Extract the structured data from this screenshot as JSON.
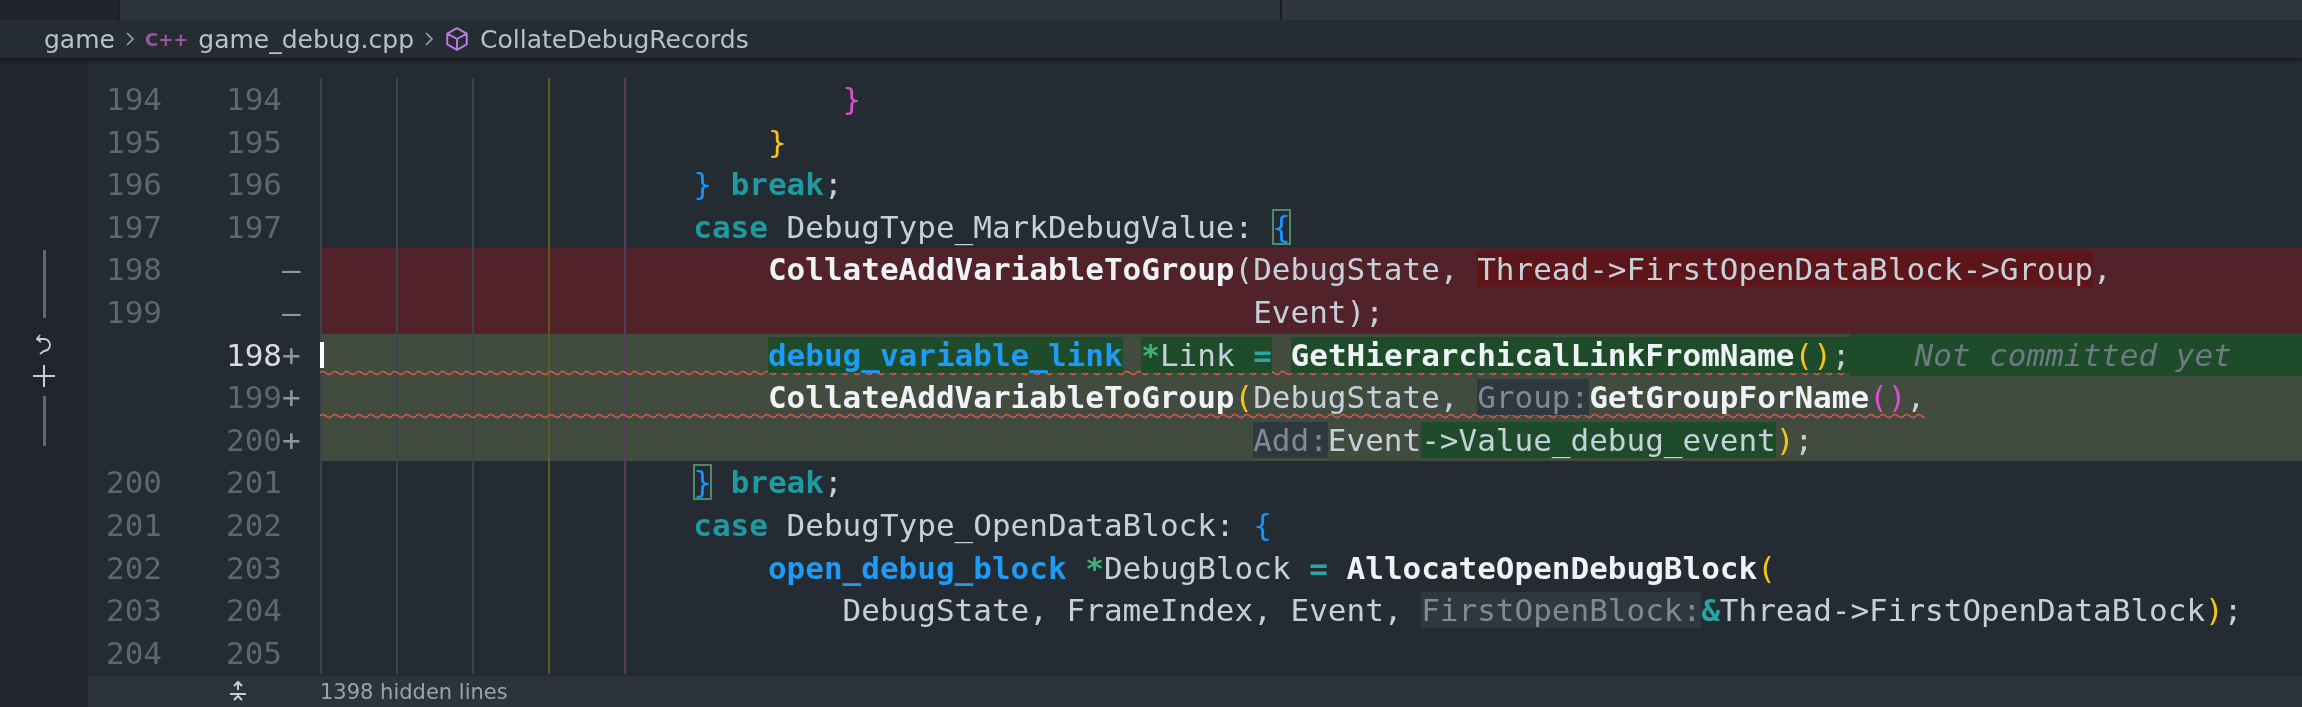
{
  "breadcrumb": [
    {
      "label": "game"
    },
    {
      "label": "game_debug.cpp",
      "icon_text": "C++"
    },
    {
      "label": "CollateDebugRecords",
      "kind": "symbol"
    }
  ],
  "lines": [
    {
      "old": "194",
      "new": "194",
      "kind": "context",
      "current": false,
      "squiggle": false,
      "tokens": [
        {
          "text": "                            }",
          "kind": "bracket3"
        }
      ]
    },
    {
      "old": "195",
      "new": "195",
      "kind": "context",
      "current": false,
      "squiggle": false,
      "tokens": [
        {
          "text": "                        }",
          "kind": "bracket2"
        }
      ]
    },
    {
      "old": "196",
      "new": "196",
      "kind": "context",
      "current": false,
      "squiggle": false,
      "tokens": [
        {
          "text": "                    }",
          "kind": "bracket1"
        },
        {
          "text": " break",
          "kind": "keyword"
        },
        {
          "text": ";",
          "kind": "plain"
        }
      ]
    },
    {
      "old": "197",
      "new": "197",
      "kind": "context",
      "current": false,
      "squiggle": false,
      "tokens": [
        {
          "text": "                    case",
          "kind": "keyword"
        },
        {
          "text": " DebugType_MarkDebugValue: ",
          "kind": "plain"
        },
        {
          "text": "{",
          "kind": "bracket1",
          "boxed": true
        }
      ]
    },
    {
      "old": "198",
      "sign": "—",
      "kind": "removed",
      "current": false,
      "squiggle": false,
      "tokens": [
        {
          "text": "                        CollateAddVariableToGroup",
          "kind": "function"
        },
        {
          "text": "(DebugState, ",
          "kind": "plain"
        },
        {
          "text": "Thread->FirstOpenDataBlock->Group",
          "kind": "plain",
          "changed": true
        },
        {
          "text": ",",
          "kind": "plain"
        }
      ]
    },
    {
      "old": "199",
      "sign": "—",
      "kind": "removed",
      "current": false,
      "squiggle": false,
      "tokens": [
        {
          "text": "                                                  Event);",
          "kind": "plain"
        }
      ]
    },
    {
      "new": "198",
      "sign": "+",
      "kind": "added",
      "current": true,
      "squiggle": true,
      "tokens": [
        {
          "text": "                        debug_variable_link",
          "kind": "type",
          "changed": true
        },
        {
          "text": " *",
          "kind": "star",
          "changed": true
        },
        {
          "text": "Link ",
          "kind": "plain",
          "changed": true
        },
        {
          "text": "=",
          "kind": "operator",
          "changed": true
        },
        {
          "text": " GetHierarchicalLinkFromName",
          "kind": "function",
          "changed": true
        },
        {
          "text": "()",
          "kind": "bracket2",
          "changed": true
        },
        {
          "text": ";",
          "kind": "plain",
          "changed": true
        }
      ],
      "annotation": "Not committed yet"
    },
    {
      "new": "199",
      "sign": "+",
      "kind": "added",
      "current": false,
      "squiggle": true,
      "tokens": [
        {
          "text": "                        CollateAddVariableToGroup",
          "kind": "function"
        },
        {
          "text": "(",
          "kind": "bracket2"
        },
        {
          "text": "DebugState, ",
          "kind": "plain"
        },
        {
          "text": "Group:",
          "kind": "hint"
        },
        {
          "text": "GetGroupForName",
          "kind": "function"
        },
        {
          "text": "()",
          "kind": "bracket3"
        },
        {
          "text": ",",
          "kind": "plain"
        }
      ]
    },
    {
      "new": "200",
      "sign": "+",
      "kind": "added",
      "current": false,
      "squiggle": false,
      "tokens": [
        {
          "text": "                                                  Add:",
          "kind": "hint"
        },
        {
          "text": "Event",
          "kind": "plain"
        },
        {
          "text": "->Value_debug_event",
          "kind": "plain",
          "changed": true
        },
        {
          "text": ")",
          "kind": "bracket2"
        },
        {
          "text": ";",
          "kind": "plain"
        }
      ]
    },
    {
      "old": "200",
      "new": "201",
      "kind": "context",
      "current": false,
      "squiggle": false,
      "tokens": [
        {
          "text": "                    }",
          "kind": "bracket1",
          "boxed": true
        },
        {
          "text": " break",
          "kind": "keyword"
        },
        {
          "text": ";",
          "kind": "plain"
        }
      ]
    },
    {
      "old": "201",
      "new": "202",
      "kind": "context",
      "current": false,
      "squiggle": false,
      "tokens": [
        {
          "text": "                    case",
          "kind": "keyword"
        },
        {
          "text": " DebugType_OpenDataBlock: ",
          "kind": "plain"
        },
        {
          "text": "{",
          "kind": "bracket1"
        }
      ]
    },
    {
      "old": "202",
      "new": "203",
      "kind": "context",
      "current": false,
      "squiggle": false,
      "tokens": [
        {
          "text": "                        open_debug_block",
          "kind": "type"
        },
        {
          "text": " *",
          "kind": "star"
        },
        {
          "text": "DebugBlock ",
          "kind": "plain"
        },
        {
          "text": "=",
          "kind": "operator"
        },
        {
          "text": " AllocateOpenDebugBlock",
          "kind": "function"
        },
        {
          "text": "(",
          "kind": "bracket2"
        }
      ]
    },
    {
      "old": "203",
      "new": "204",
      "kind": "context",
      "current": false,
      "squiggle": false,
      "tokens": [
        {
          "text": "                            DebugState, FrameIndex, Event, ",
          "kind": "plain"
        },
        {
          "text": "FirstOpenBlock:",
          "kind": "hint"
        },
        {
          "text": "&",
          "kind": "operator"
        },
        {
          "text": "Thread->FirstOpenDataBlock",
          "kind": "plain"
        },
        {
          "text": ")",
          "kind": "bracket2"
        },
        {
          "text": ";",
          "kind": "plain"
        }
      ]
    },
    {
      "old": "204",
      "new": "205",
      "kind": "context",
      "current": false,
      "squiggle": false
    }
  ],
  "fold": {
    "label": "1398 hidden lines"
  }
}
